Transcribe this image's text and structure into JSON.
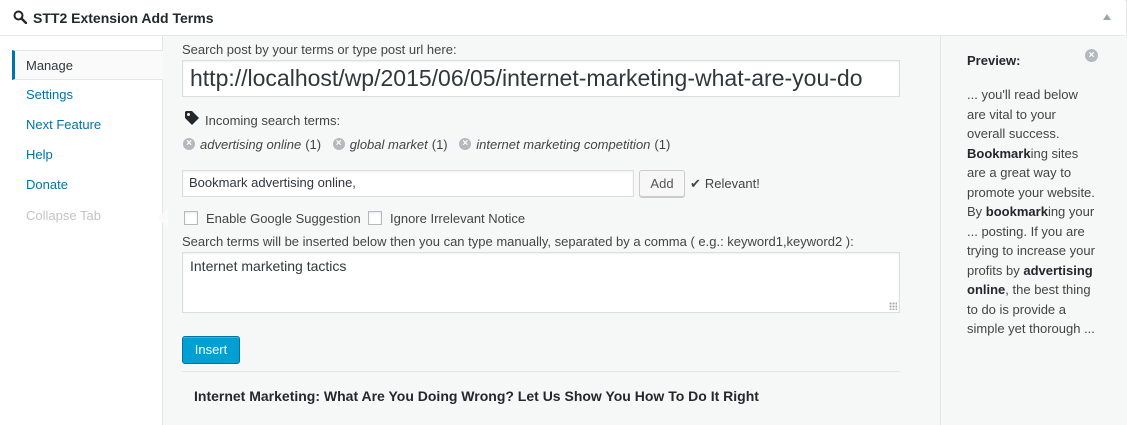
{
  "header": {
    "title": "STT2 Extension Add Terms",
    "icon": "search-icon"
  },
  "sidebar": {
    "items": [
      {
        "label": "Manage",
        "state": "active"
      },
      {
        "label": "Settings"
      },
      {
        "label": "Next Feature"
      },
      {
        "label": "Help"
      },
      {
        "label": "Donate"
      },
      {
        "label": "Collapse Tab",
        "state": "muted"
      }
    ]
  },
  "main": {
    "url_label": "Search post by your terms or type post url here:",
    "url_value": "http://localhost/wp/2015/06/05/internet-marketing-what-are-you-do",
    "incoming_label": "Incoming search terms:",
    "terms": [
      {
        "text": "advertising online",
        "count": "(1)"
      },
      {
        "text": "global market",
        "count": "(1)"
      },
      {
        "text": "internet marketing competition",
        "count": "(1)"
      }
    ],
    "keyword_value": "Bookmark advertising online,",
    "add_button": "Add",
    "relevant_text": "Relevant!",
    "google_suggestion_label": "Enable Google Suggestion",
    "ignore_notice_label": "Ignore Irrelevant Notice",
    "instructions": "Search terms will be inserted below then you can type manually, separated by a comma ( e.g.: keyword1,keyword2 ):",
    "terms_textarea": "Internet marketing tactics",
    "insert_button": "Insert",
    "post_title": "Internet Marketing: What Are You Doing Wrong? Let Us Show You How To Do It Right"
  },
  "preview": {
    "title": "Preview:",
    "segments": [
      {
        "t": "...  you'll read below are vital to your overall success. ",
        "b": false
      },
      {
        "t": "Bookmark",
        "b": true
      },
      {
        "t": "ing sites are a great way to promote your website. By ",
        "b": false
      },
      {
        "t": "bookmark",
        "b": true
      },
      {
        "t": "ing your ...  posting. If you are trying to increase your profits by ",
        "b": false
      },
      {
        "t": "advertising online",
        "b": true
      },
      {
        "t": ", the best thing to do is provide a simple yet thorough ...",
        "b": false
      }
    ]
  },
  "colors": {
    "accent": "#0073aa",
    "primary_button": "#00a0d2"
  }
}
